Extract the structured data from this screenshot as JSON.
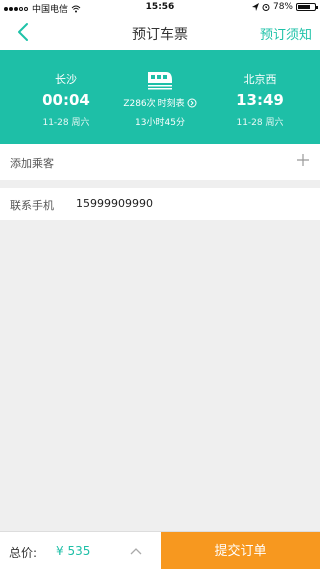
{
  "status_bar": {
    "carrier": "中国电信",
    "time": "15:56",
    "battery": "78%",
    "battery_level": 0.78
  },
  "nav": {
    "title": "预订车票",
    "notice_link": "预订须知"
  },
  "trip": {
    "from": {
      "station": "长沙",
      "time": "00:04",
      "date": "11-28 周六"
    },
    "to": {
      "station": "北京西",
      "time": "13:49",
      "date": "11-28 周六"
    },
    "train_number": "Z286次",
    "timetable_label": "时刻表",
    "duration": "13小时45分"
  },
  "passenger": {
    "add_label": "添加乘客"
  },
  "contact": {
    "label": "联系手机",
    "phone": "15999909990"
  },
  "footer": {
    "total_label": "总价:",
    "total_value": "¥ 535",
    "submit_label": "提交订单"
  },
  "colors": {
    "accent": "#1ebfa7",
    "submit": "#f7981f"
  }
}
